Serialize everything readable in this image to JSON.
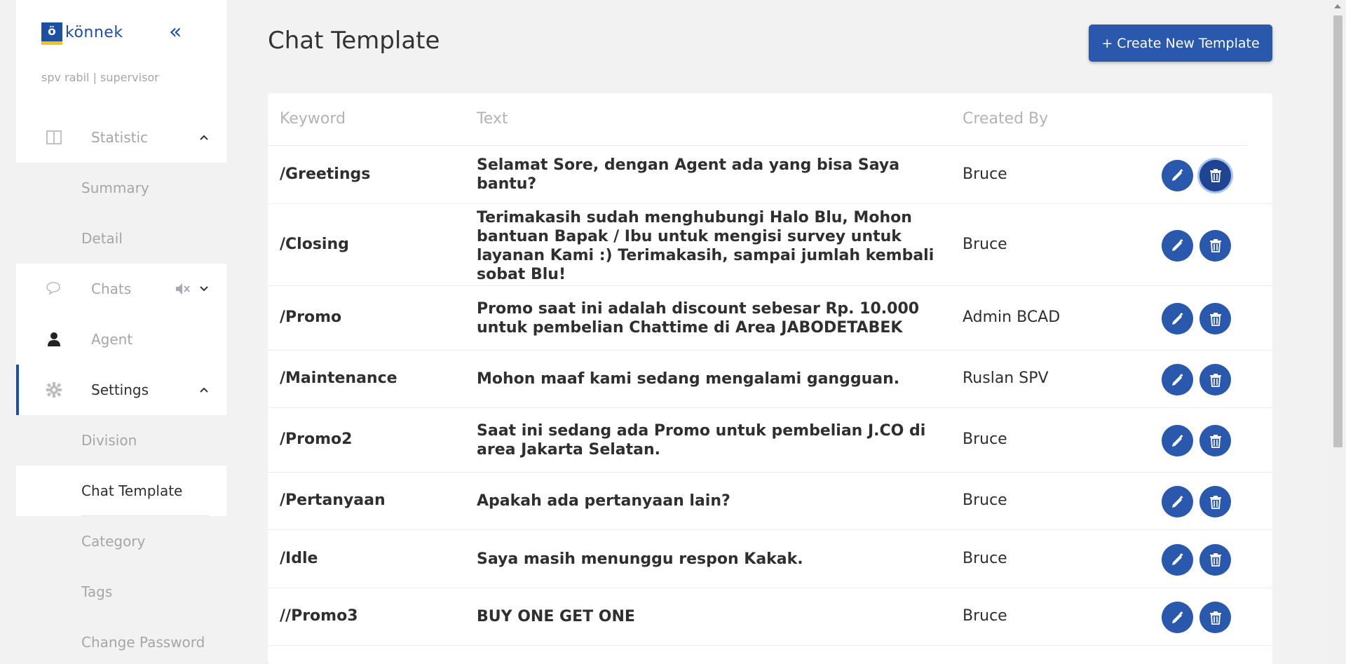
{
  "app": {
    "logo_mark": "ö",
    "logo_text": "könnek",
    "user_line": "spv rabil | supervisor"
  },
  "sidebar": {
    "items": [
      {
        "label": "Statistic",
        "icon": "columns-icon",
        "caret": "chevron-up-icon"
      },
      {
        "label": "Summary"
      },
      {
        "label": "Detail"
      },
      {
        "label": "Chats",
        "icon": "chat-icon",
        "caret": "chevron-down-icon",
        "badge_icon": "mute-icon"
      },
      {
        "label": "Agent",
        "icon": "user-icon"
      },
      {
        "label": "Settings",
        "icon": "gear-icon",
        "caret": "chevron-up-icon"
      },
      {
        "label": "Division"
      },
      {
        "label": "Chat Template"
      },
      {
        "label": "Category"
      },
      {
        "label": "Tags"
      },
      {
        "label": "Change Password"
      }
    ]
  },
  "header": {
    "title": "Chat Template",
    "create_label": "+ Create New Template"
  },
  "table": {
    "columns": [
      "Keyword",
      "Text",
      "Created By"
    ],
    "rows": [
      {
        "keyword": "/Greetings",
        "text": "Selamat Sore, dengan Agent ada yang bisa Saya bantu?",
        "created_by": "Bruce"
      },
      {
        "keyword": "/Closing",
        "text": "Terimakasih sudah menghubungi Halo Blu, Mohon bantuan Bapak / Ibu untuk mengisi survey untuk layanan Kami :) Terimakasih, sampai jumlah kembali sobat Blu!",
        "created_by": "Bruce"
      },
      {
        "keyword": "/Promo",
        "text": "Promo saat ini adalah discount sebesar Rp. 10.000 untuk pembelian Chattime di Area JABODETABEK",
        "created_by": "Admin BCAD"
      },
      {
        "keyword": "/Maintenance",
        "text": "Mohon maaf kami sedang mengalami gangguan.",
        "created_by": "Ruslan SPV"
      },
      {
        "keyword": "/Promo2",
        "text": "Saat ini sedang ada Promo untuk pembelian J.CO di area Jakarta Selatan.",
        "created_by": "Bruce"
      },
      {
        "keyword": "/Pertanyaan",
        "text": "Apakah ada pertanyaan lain?",
        "created_by": "Bruce"
      },
      {
        "keyword": "/Idle",
        "text": "Saya masih menunggu respon Kakak.",
        "created_by": "Bruce"
      },
      {
        "keyword": "//Promo3",
        "text": "BUY ONE GET ONE",
        "created_by": "Bruce"
      }
    ]
  },
  "colors": {
    "accent": "#2a58ad",
    "logo_yellow": "#f0c419",
    "muted_text": "#a6a6a6"
  }
}
